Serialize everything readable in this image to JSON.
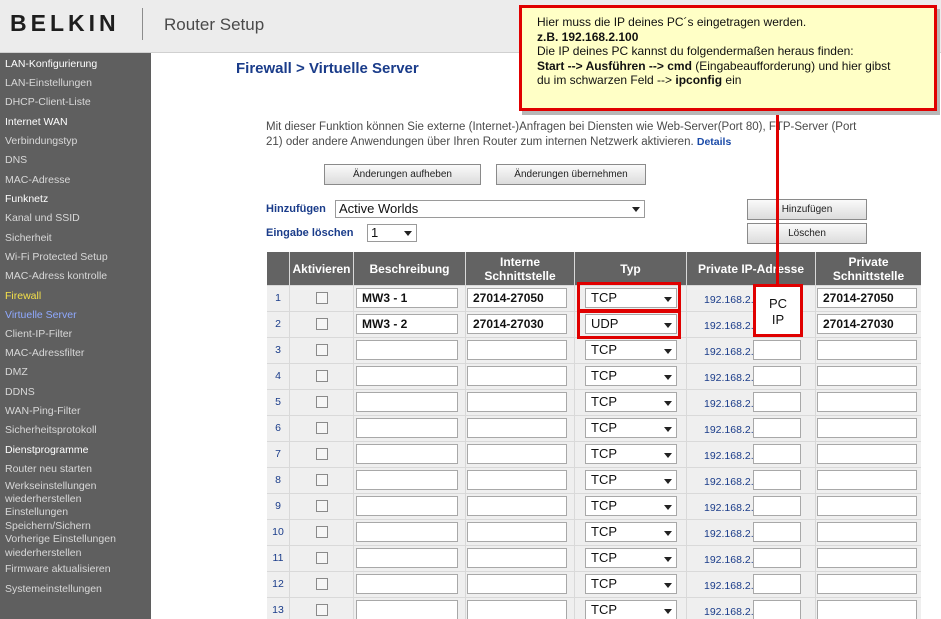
{
  "header": {
    "brand": "BELKIN",
    "title": "Router Setup"
  },
  "sidebar": {
    "items": [
      {
        "label": "LAN-Konfigurierung",
        "kind": "head"
      },
      {
        "label": "LAN-Einstellungen",
        "kind": "link"
      },
      {
        "label": "DHCP-Client-Liste",
        "kind": "link"
      },
      {
        "label": "Internet WAN",
        "kind": "head"
      },
      {
        "label": "Verbindungstyp",
        "kind": "link"
      },
      {
        "label": "DNS",
        "kind": "link"
      },
      {
        "label": "MAC-Adresse",
        "kind": "link"
      },
      {
        "label": "Funknetz",
        "kind": "head"
      },
      {
        "label": "Kanal und SSID",
        "kind": "link"
      },
      {
        "label": "Sicherheit",
        "kind": "link"
      },
      {
        "label": "Wi-Fi Protected Setup",
        "kind": "link"
      },
      {
        "label": "MAC-Adress kontrolle",
        "kind": "link"
      },
      {
        "label": "Firewall",
        "kind": "active"
      },
      {
        "label": "Virtuelle Server",
        "kind": "current"
      },
      {
        "label": "Client-IP-Filter",
        "kind": "link"
      },
      {
        "label": "MAC-Adressfilter",
        "kind": "link"
      },
      {
        "label": "DMZ",
        "kind": "link"
      },
      {
        "label": "DDNS",
        "kind": "link"
      },
      {
        "label": "WAN-Ping-Filter",
        "kind": "link"
      },
      {
        "label": "Sicherheitsprotokoll",
        "kind": "link"
      },
      {
        "label": "Dienstprogramme",
        "kind": "head"
      },
      {
        "label": "Router neu starten",
        "kind": "link"
      },
      {
        "label": "Werkseinstellungen",
        "kind": "link"
      },
      {
        "label": "wiederherstellen",
        "kind": "link"
      },
      {
        "label": "Einstellungen",
        "kind": "link"
      },
      {
        "label": "Speichern/Sichern",
        "kind": "link"
      },
      {
        "label": "Vorherige Einstellungen",
        "kind": "link"
      },
      {
        "label": "wiederherstellen",
        "kind": "link"
      },
      {
        "label": "Firmware aktualisieren",
        "kind": "link"
      },
      {
        "label": "Systemeinstellungen",
        "kind": "link"
      }
    ]
  },
  "main": {
    "page_title": "Firewall > Virtuelle Server",
    "description": "Mit dieser Funktion können Sie externe (Internet-)Anfragen bei Diensten wie Web-Server(Port 80), FTP-Server (Port 21) oder andere Anwendungen über Ihren Router zum internen Netzwerk aktivieren.",
    "details_link": "Details",
    "clear_button": "Änderungen aufheben",
    "apply_button": "Änderungen übernehmen",
    "add_label": "Hinzufügen",
    "add_select": "Active Worlds",
    "add_button": "Hinzufügen",
    "delete_label": "Eingabe löschen",
    "delete_select": "1",
    "delete_button": "Löschen"
  },
  "table": {
    "headers": {
      "activate": "Aktivieren",
      "description": "Beschreibung",
      "internal_port": "Interne Schnittstelle",
      "type": "Typ",
      "private_ip": "Private IP-Adresse",
      "private_port": "Private Schnittstelle"
    },
    "rows": [
      {
        "num": "1",
        "desc": "MW3 - 1",
        "port": "27014-27050",
        "type": "TCP",
        "ip": "192.168.2.",
        "pport": "27014-27050"
      },
      {
        "num": "2",
        "desc": "MW3 - 2",
        "port": "27014-27030",
        "type": "UDP",
        "ip": "192.168.2.",
        "pport": "27014-27030"
      },
      {
        "num": "3",
        "desc": "",
        "port": "",
        "type": "TCP",
        "ip": "192.168.2.",
        "pport": ""
      },
      {
        "num": "4",
        "desc": "",
        "port": "",
        "type": "TCP",
        "ip": "192.168.2.",
        "pport": ""
      },
      {
        "num": "5",
        "desc": "",
        "port": "",
        "type": "TCP",
        "ip": "192.168.2.",
        "pport": ""
      },
      {
        "num": "6",
        "desc": "",
        "port": "",
        "type": "TCP",
        "ip": "192.168.2.",
        "pport": ""
      },
      {
        "num": "7",
        "desc": "",
        "port": "",
        "type": "TCP",
        "ip": "192.168.2.",
        "pport": ""
      },
      {
        "num": "8",
        "desc": "",
        "port": "",
        "type": "TCP",
        "ip": "192.168.2.",
        "pport": ""
      },
      {
        "num": "9",
        "desc": "",
        "port": "",
        "type": "TCP",
        "ip": "192.168.2.",
        "pport": ""
      },
      {
        "num": "10",
        "desc": "",
        "port": "",
        "type": "TCP",
        "ip": "192.168.2.",
        "pport": ""
      },
      {
        "num": "11",
        "desc": "",
        "port": "",
        "type": "TCP",
        "ip": "192.168.2.",
        "pport": ""
      },
      {
        "num": "12",
        "desc": "",
        "port": "",
        "type": "TCP",
        "ip": "192.168.2.",
        "pport": ""
      },
      {
        "num": "13",
        "desc": "",
        "port": "",
        "type": "TCP",
        "ip": "192.168.2.",
        "pport": ""
      }
    ]
  },
  "annotation": {
    "line1": "Hier muss die IP deines PC´s eingetragen werden.",
    "line2": "z.B. 192.168.2.100",
    "line3": "Die IP deines PC kannst du folgendermaßen heraus finden:",
    "line4_start": "Start --> Ausführen --> cmd",
    "line4_rest": " (Eingabeaufforderung) und hier gibst",
    "line5_start": "du im schwarzen Feld --> ",
    "line5_cmd": "ipconfig",
    "line5_end": " ein",
    "pc": "PC",
    "ip": "IP"
  },
  "colors": {
    "accent": "#1a3c8a",
    "highlight": "#e00000",
    "callout_bg": "#ffffc6",
    "sidebar_bg": "#5f5f5f"
  }
}
